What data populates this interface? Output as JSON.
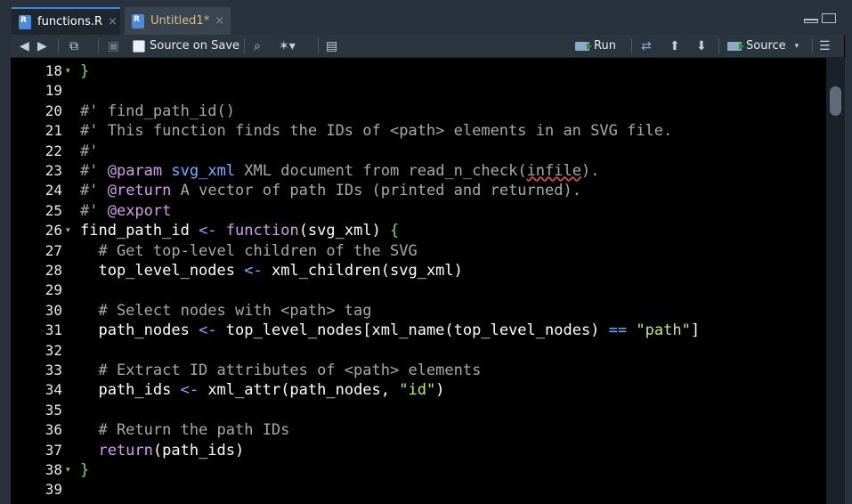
{
  "tabs": [
    {
      "label": "functions.R",
      "close": "×"
    },
    {
      "label": "Untitled1*",
      "close": "×"
    }
  ],
  "toolbar": {
    "source_on_save": "Source on Save",
    "run": "Run",
    "source": "Source"
  },
  "editor": {
    "lines": [
      {
        "n": "18",
        "fold": "▾",
        "segs": [
          [
            "c-brace",
            "}"
          ]
        ]
      },
      {
        "n": "19",
        "segs": []
      },
      {
        "n": "20",
        "segs": [
          [
            "c-comment",
            "#' find_path_id()"
          ]
        ]
      },
      {
        "n": "21",
        "segs": [
          [
            "c-comment",
            "#' This function finds the IDs of <path> elements in an SVG file."
          ]
        ]
      },
      {
        "n": "22",
        "segs": [
          [
            "c-comment",
            "#'"
          ]
        ]
      },
      {
        "n": "23",
        "segs": [
          [
            "c-comment",
            "#' "
          ],
          [
            "c-rox",
            "@param"
          ],
          [
            "c-comment",
            " "
          ],
          [
            "c-param",
            "svg_xml"
          ],
          [
            "c-comment",
            " XML document from read_n_check("
          ],
          [
            "c-comment squig",
            "infile"
          ],
          [
            "c-comment",
            ")."
          ]
        ]
      },
      {
        "n": "24",
        "segs": [
          [
            "c-comment",
            "#' "
          ],
          [
            "c-rox",
            "@return"
          ],
          [
            "c-comment",
            " A vector of path IDs (printed and returned)."
          ]
        ]
      },
      {
        "n": "25",
        "segs": [
          [
            "c-comment",
            "#' "
          ],
          [
            "c-rox",
            "@export"
          ]
        ]
      },
      {
        "n": "26",
        "fold": "▾",
        "segs": [
          [
            "c-txt",
            "find_path_id "
          ],
          [
            "c-op",
            "<-"
          ],
          [
            "c-txt",
            " "
          ],
          [
            "c-kw",
            "function"
          ],
          [
            "c-txt",
            "(svg_xml) "
          ],
          [
            "c-brace",
            "{"
          ]
        ]
      },
      {
        "n": "27",
        "segs": [
          [
            "c-comment",
            "  # Get top-level children of the SVG"
          ]
        ]
      },
      {
        "n": "28",
        "segs": [
          [
            "c-txt",
            "  top_level_nodes "
          ],
          [
            "c-op",
            "<-"
          ],
          [
            "c-txt",
            " xml_children(svg_xml)"
          ]
        ]
      },
      {
        "n": "29",
        "segs": []
      },
      {
        "n": "30",
        "segs": [
          [
            "c-comment",
            "  # Select nodes with <path> tag"
          ]
        ]
      },
      {
        "n": "31",
        "segs": [
          [
            "c-txt",
            "  path_nodes "
          ],
          [
            "c-op",
            "<-"
          ],
          [
            "c-txt",
            " top_level_nodes[xml_name(top_level_nodes) "
          ],
          [
            "c-op",
            "=="
          ],
          [
            "c-txt",
            " "
          ],
          [
            "c-str",
            "\"path\""
          ],
          [
            "c-txt",
            "]"
          ]
        ]
      },
      {
        "n": "32",
        "segs": []
      },
      {
        "n": "33",
        "segs": [
          [
            "c-comment",
            "  # Extract ID attributes of <path> elements"
          ]
        ]
      },
      {
        "n": "34",
        "segs": [
          [
            "c-txt",
            "  path_ids "
          ],
          [
            "c-op",
            "<-"
          ],
          [
            "c-txt",
            " xml_attr(path_nodes, "
          ],
          [
            "c-str",
            "\"id\""
          ],
          [
            "c-txt",
            ")"
          ]
        ]
      },
      {
        "n": "35",
        "segs": []
      },
      {
        "n": "36",
        "segs": [
          [
            "c-comment",
            "  # Return the path IDs"
          ]
        ]
      },
      {
        "n": "37",
        "segs": [
          [
            "c-kw",
            "  return"
          ],
          [
            "c-txt",
            "(path_ids)"
          ]
        ]
      },
      {
        "n": "38",
        "fold": "▾",
        "segs": [
          [
            "c-brace",
            "}"
          ]
        ]
      },
      {
        "n": "39",
        "segs": []
      }
    ]
  }
}
